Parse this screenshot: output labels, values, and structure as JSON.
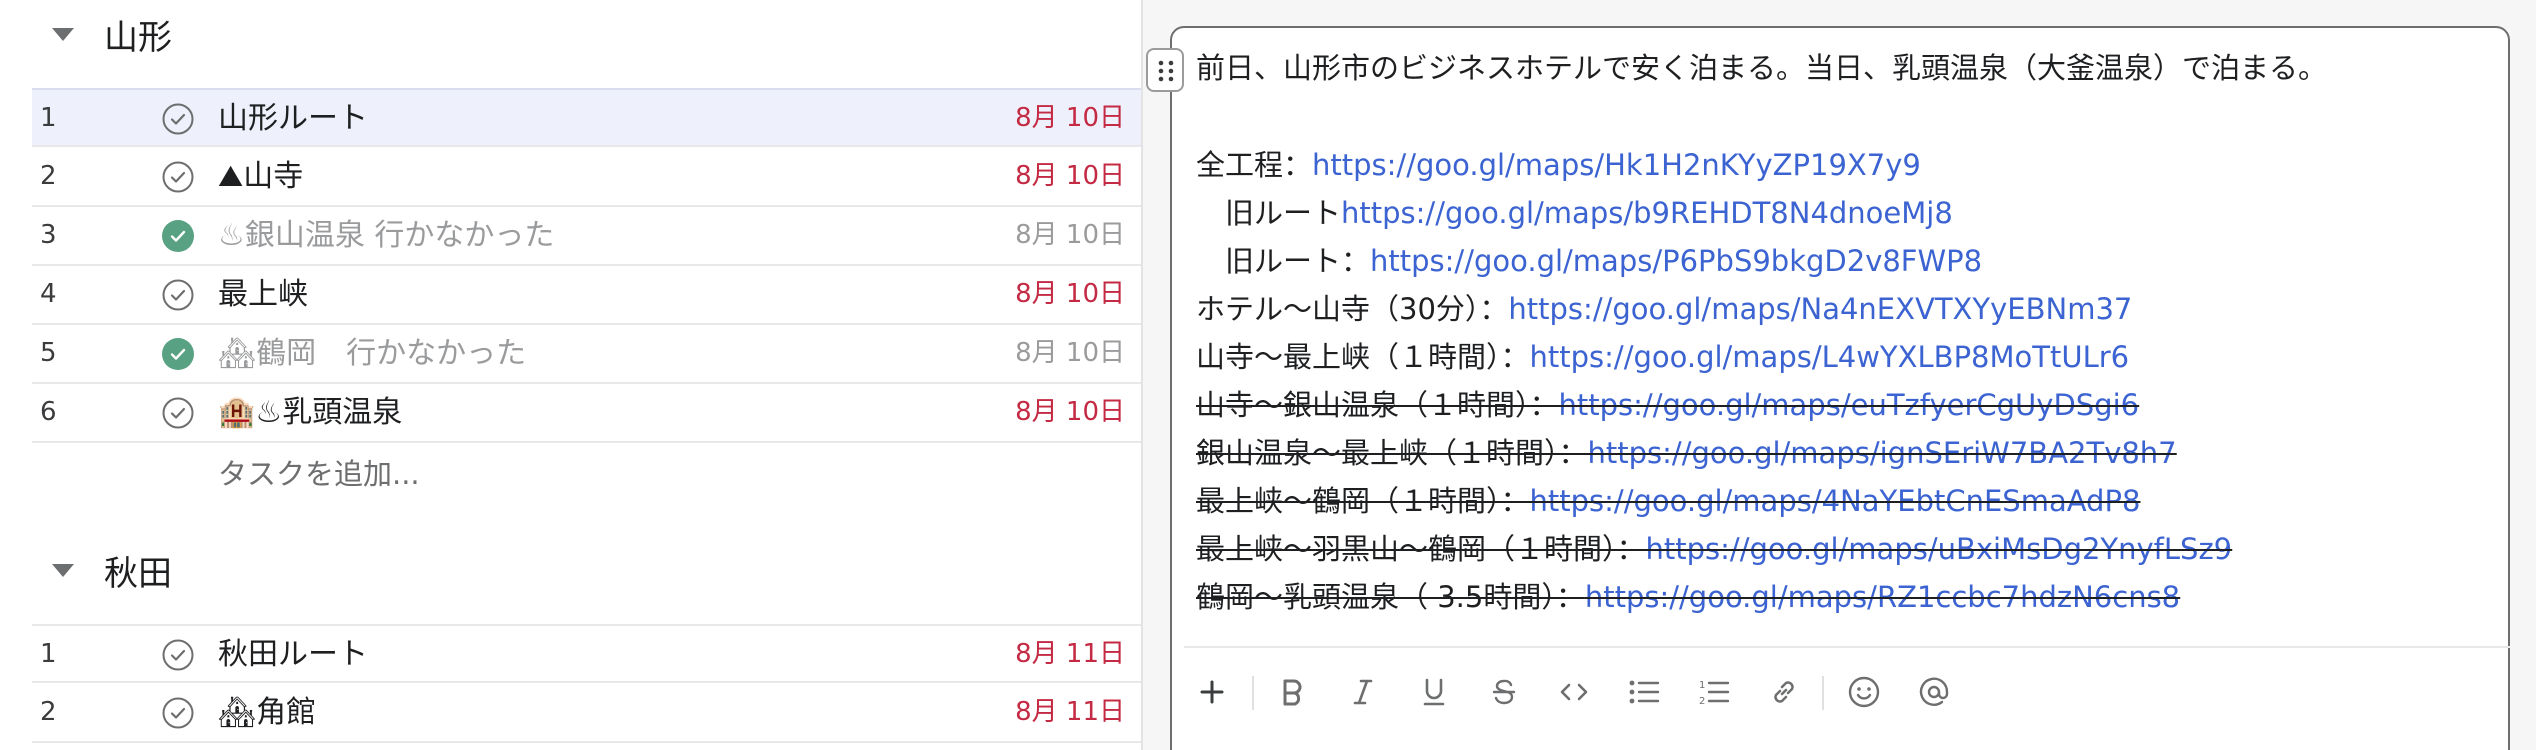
{
  "sections": [
    {
      "title": "山形",
      "tasks": [
        {
          "num": "1",
          "name": "山形ルート",
          "date": "8月 10日",
          "done": false,
          "highlight": true
        },
        {
          "num": "2",
          "name": "⛰山寺",
          "date": "8月 10日",
          "done": false
        },
        {
          "num": "3",
          "name": "♨銀山温泉 行かなかった",
          "date": "8月 10日",
          "done": true
        },
        {
          "num": "4",
          "name": "最上峡",
          "date": "8月 10日",
          "done": false
        },
        {
          "num": "5",
          "name": "🏘鶴岡　行かなかった",
          "date": "8月 10日",
          "done": true
        },
        {
          "num": "6",
          "name": "🏨♨乳頭温泉",
          "date": "8月 10日",
          "done": false
        }
      ],
      "add_task_label": "タスクを追加..."
    },
    {
      "title": "秋田",
      "tasks": [
        {
          "num": "1",
          "name": "秋田ルート",
          "date": "8月 11日",
          "done": false
        },
        {
          "num": "2",
          "name": "🏘角館",
          "date": "8月 11日",
          "done": false
        }
      ]
    }
  ],
  "notes": {
    "intro": "前日、山形市のビジネスホテルで安く泊まる。当日、乳頭温泉（大釜温泉）で泊まる。",
    "lines": [
      {
        "label": "全工程：",
        "url": "https://goo.gl/maps/Hk1H2nKYyZP19X7y9",
        "strike": false
      },
      {
        "label": "　旧ルート",
        "url": "https://goo.gl/maps/b9REHDT8N4dnoeMj8",
        "strike": false
      },
      {
        "label": "　旧ルート：",
        "url": "https://goo.gl/maps/P6PbS9bkgD2v8FWP8",
        "strike": false
      },
      {
        "label": "ホテル〜山寺（30分）：",
        "url": "https://goo.gl/maps/Na4nEXVTXYyEBNm37",
        "strike": false
      },
      {
        "label": "山寺〜最上峡（１時間）：",
        "url": "https://goo.gl/maps/L4wYXLBP8MoTtULr6",
        "strike": false
      },
      {
        "label": "山寺〜銀山温泉（１時間）：",
        "url": "https://goo.gl/maps/euTzfyerCgUyDSgi6",
        "strike": true
      },
      {
        "label": "銀山温泉〜最上峡（１時間）：",
        "url": "https://goo.gl/maps/ignSEriW7BA2Tv8h7",
        "strike": true
      },
      {
        "label": "最上峡〜鶴岡（１時間）：",
        "url": "https://goo.gl/maps/4NaYEbtCnESmaAdP8",
        "strike": true
      },
      {
        "label": "最上峡〜羽黒山〜鶴岡（１時間）：",
        "url": "https://goo.gl/maps/uBxiMsDg2YnyfLSz9",
        "strike": true
      },
      {
        "label": "鶴岡〜乳頭温泉（ 3.5時間）：",
        "url": "https://goo.gl/maps/RZ1ccbc7hdzN6cns8",
        "strike": true
      }
    ]
  },
  "toolbar": {
    "icons": [
      "plus-icon",
      "bold-icon",
      "italic-icon",
      "underline-icon",
      "strikethrough-icon",
      "code-icon",
      "bullet-list-icon",
      "numbered-list-icon",
      "link-icon",
      "emoji-icon",
      "mention-icon"
    ]
  },
  "colors": {
    "due_date": "#c42a43",
    "link": "#3b63d1",
    "done_check": "#58a182",
    "row_highlight": "#eef0fb"
  }
}
